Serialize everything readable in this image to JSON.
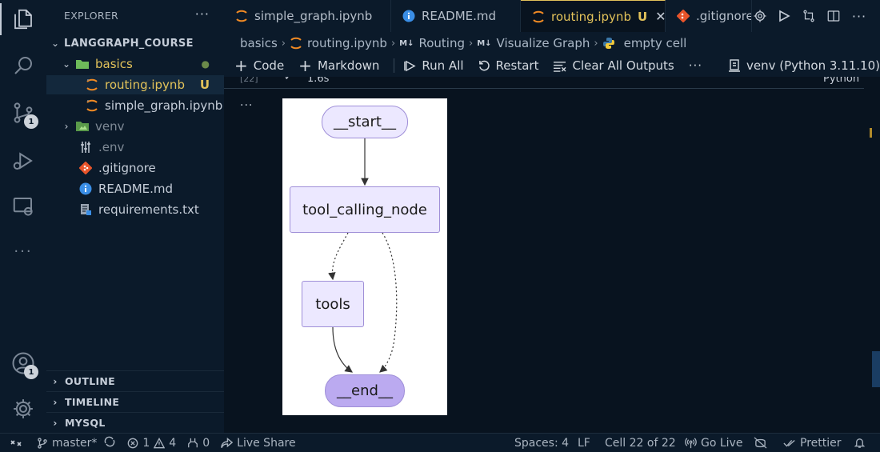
{
  "activity_bar": {
    "source_control_badge": "1",
    "accounts_badge": "1"
  },
  "sidebar": {
    "header": "EXPLORER",
    "more": "···",
    "project": "LANGGRAPH_COURSE",
    "tree": [
      {
        "label": "basics",
        "type": "folder-open",
        "status": "●"
      },
      {
        "label": "routing.ipynb",
        "type": "notebook",
        "status": "U"
      },
      {
        "label": "simple_graph.ipynb",
        "type": "notebook",
        "status": ""
      },
      {
        "label": "venv",
        "type": "folder",
        "status": ""
      },
      {
        "label": ".env",
        "type": "env",
        "status": ""
      },
      {
        "label": ".gitignore",
        "type": "git",
        "status": ""
      },
      {
        "label": "README.md",
        "type": "info",
        "status": ""
      },
      {
        "label": "requirements.txt",
        "type": "text",
        "status": ""
      }
    ],
    "sections": [
      "OUTLINE",
      "TIMELINE",
      "MYSQL"
    ]
  },
  "tabs": [
    {
      "label": "simple_graph.ipynb",
      "status": ""
    },
    {
      "label": "README.md",
      "status": ""
    },
    {
      "label": "routing.ipynb",
      "status": "U"
    },
    {
      "label": ".gitignore",
      "status": ""
    }
  ],
  "breadcrumb": [
    "basics",
    "routing.ipynb",
    "Routing",
    "Visualize Graph",
    "empty cell"
  ],
  "toolbar": {
    "code": "Code",
    "markdown": "Markdown",
    "run_all": "Run All",
    "restart": "Restart",
    "clear_outputs": "Clear All Outputs",
    "more": "···",
    "kernel": "venv (Python 3.11.10)"
  },
  "cell": {
    "exec_count": "[22]",
    "duration": "1.6s",
    "language": "Python",
    "output_more": "···"
  },
  "graph": {
    "nodes": {
      "start": "__start__",
      "tool_calling_node": "tool_calling_node",
      "tools": "tools",
      "end": "__end__"
    }
  },
  "statusbar": {
    "branch": "master*",
    "errors": "1",
    "warnings": "4",
    "ports": "0",
    "live_share": "Live Share",
    "spaces": "Spaces: 4",
    "eol": "LF",
    "cell_pos": "Cell 22 of 22",
    "go_live": "Go Live",
    "prettier": "Prettier"
  },
  "colors": {
    "background": "#0b1a2a",
    "editor": "#08131f",
    "accent": "#e2c25a",
    "node_fill": "#ece8ff",
    "node_border": "#9f8fd8",
    "end_fill": "#bbaaf0"
  }
}
